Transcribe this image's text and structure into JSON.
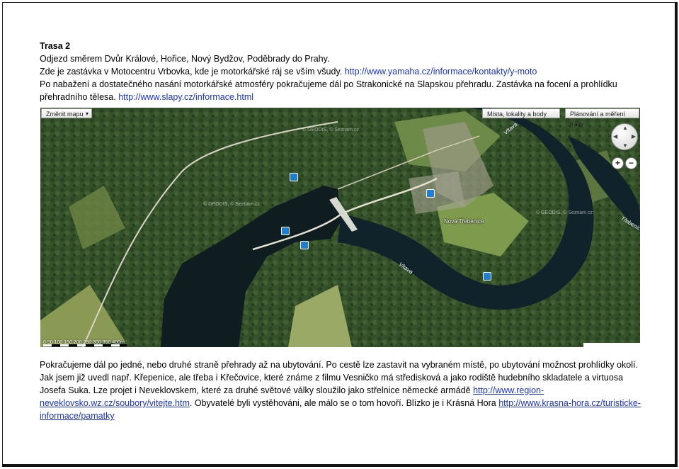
{
  "top": {
    "title": "Trasa 2",
    "line1": "Odjezd směrem Dvůr Králové, Hořice, Nový Bydžov, Poděbrady do Prahy.",
    "line2_text": "Zde je zastávka v Motocentru Vrbovka, kde je motorkářské ráj se vším všudy. ",
    "line2_link": "http://www.yamaha.cz/informace/kontakty/y-moto",
    "line3": "Po nabažení a dostatečného nasání motorkářské atmosféry pokračujeme dál po Strakonické na Slapskou přehradu. Zastávka na focení a prohlídku přehradního tělesa. ",
    "line3_link": "http://www.slapy.cz/informace.html"
  },
  "map": {
    "change_map_label": "Změnit mapu",
    "places_label": "Místa, lokality a body",
    "planning_label": "Plánování a měření trasy",
    "zoom_in": "+",
    "zoom_out": "−",
    "town_label": "Nová Třebenice",
    "river_label_1": "Vltava",
    "river_label_2": "Vltava",
    "river_label_3": "Třebenice",
    "watermark_1": "© GEODIS, © Seznam.cz",
    "watermark_2": "© GEODIS, © Seznam.cz",
    "watermark_3": "© GEODIS, © Seznam.cz",
    "scale_label": "0  50 100 150 200 250 300 350 400m"
  },
  "bottom": {
    "para1": "Pokračujeme dál po jedné, nebo druhé straně přehrady až na ubytování. Po cestě lze zastavit na vybraném místě, po ubytování možnost prohlídky okolí. Jak jsem již uvedl např. Křepenice, ale třeba i Křečovice, které známe z filmu Vesničko má středisková a jako rodiště hudebního skladatele a virtuosa Josefa Suka. Lze projet i Neveklovskem, které za druhé světové války sloužilo jako střelnice německé armádě ",
    "link1": "http://www.region-neveklovsko.wz.cz/soubory/vitejte.htm",
    "para2": ". Obyvatelé byli vystěhováni, ale málo se o tom hovoří. Blízko je i Krásná Hora ",
    "link2": "http://www.krasna-hora.cz/turisticke-informace/pamatky"
  }
}
